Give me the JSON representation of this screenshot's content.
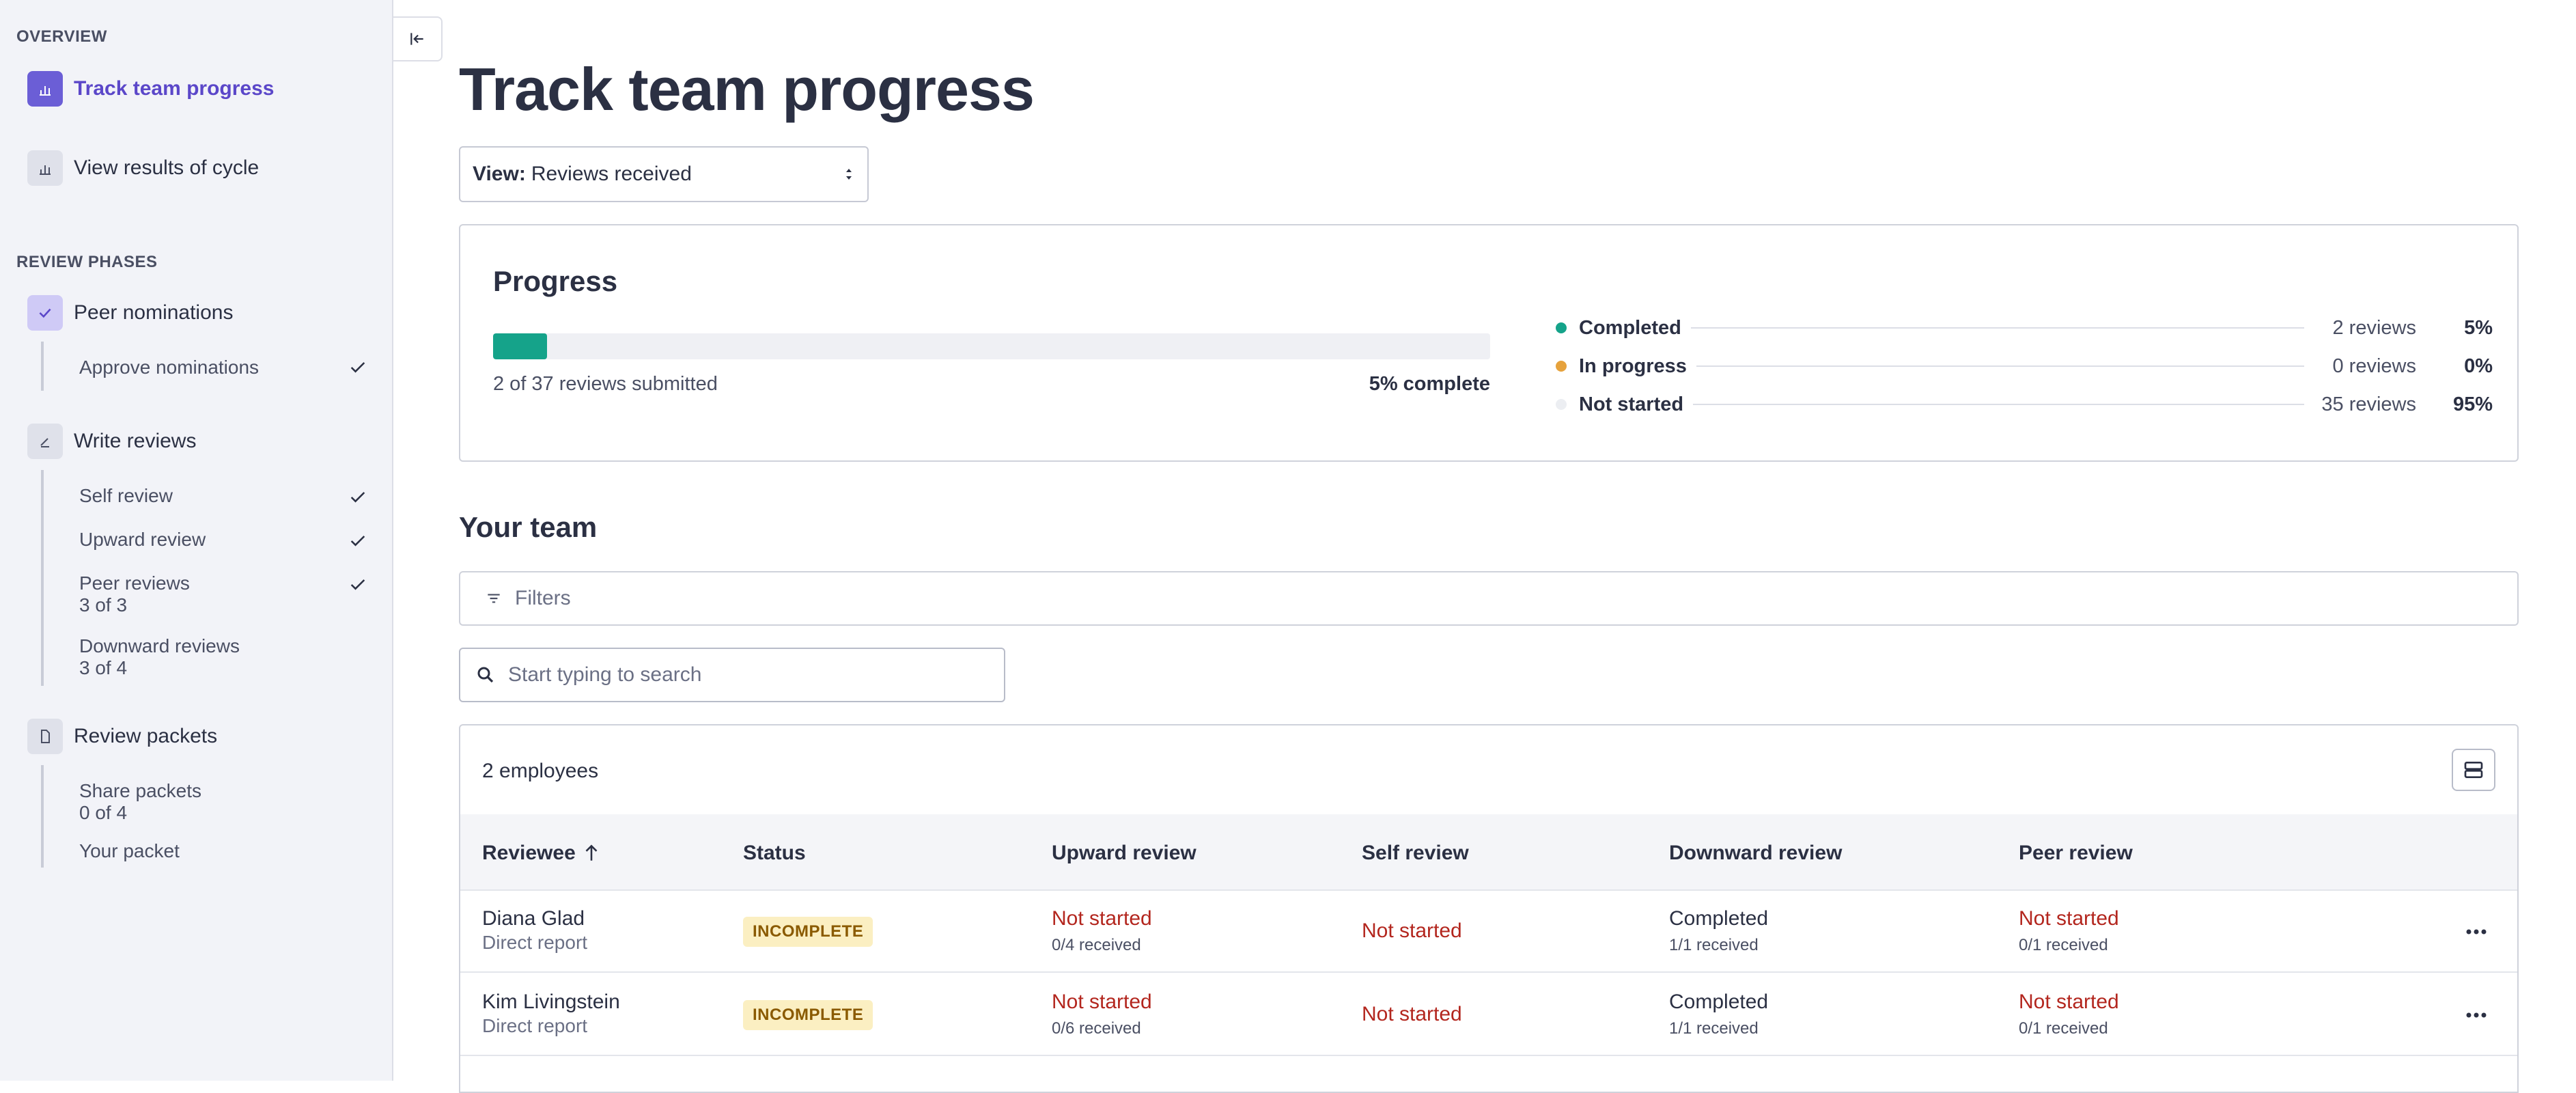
{
  "sidebar": {
    "overview_label": "OVERVIEW",
    "overview_items": [
      {
        "label": "Track team progress",
        "icon": "bar-chart-icon",
        "active": true
      },
      {
        "label": "View results of cycle",
        "icon": "bar-chart-icon",
        "active": false
      }
    ],
    "phases_label": "REVIEW PHASES",
    "phases": [
      {
        "label": "Peer nominations",
        "icon": "check-icon",
        "items": [
          {
            "label": "Approve nominations",
            "sub": "",
            "done": true
          }
        ]
      },
      {
        "label": "Write reviews",
        "icon": "pencil-icon",
        "items": [
          {
            "label": "Self review",
            "sub": "",
            "done": true
          },
          {
            "label": "Upward review",
            "sub": "",
            "done": true
          },
          {
            "label": "Peer reviews",
            "sub": "3 of 3",
            "done": true
          },
          {
            "label": "Downward reviews",
            "sub": "3 of 4",
            "done": false
          }
        ]
      },
      {
        "label": "Review packets",
        "icon": "document-icon",
        "items": [
          {
            "label": "Share packets",
            "sub": "0 of 4",
            "done": false
          },
          {
            "label": "Your packet",
            "sub": "",
            "done": false
          }
        ]
      }
    ]
  },
  "main": {
    "title": "Track team progress",
    "view_select": {
      "prefix": "View:",
      "value": "Reviews received"
    },
    "progress": {
      "title": "Progress",
      "fraction": 0.054,
      "submitted_text": "2 of 37 reviews submitted",
      "complete_text": "5% complete",
      "legend": [
        {
          "name": "Completed",
          "count": "2 reviews",
          "pct": "5%",
          "color": "#15a38a"
        },
        {
          "name": "In progress",
          "count": "0 reviews",
          "pct": "0%",
          "color": "#e6a23c"
        },
        {
          "name": "Not started",
          "count": "35 reviews",
          "pct": "95%",
          "color": "#eceef2"
        }
      ]
    },
    "team": {
      "title": "Your team",
      "filters_label": "Filters",
      "search_placeholder": "Start typing to search",
      "employee_count": "2 employees",
      "columns": [
        "Reviewee",
        "Status",
        "Upward review",
        "Self review",
        "Downward review",
        "Peer review"
      ],
      "rows": [
        {
          "name": "Diana Glad",
          "relation": "Direct report",
          "status": "INCOMPLETE",
          "upward": {
            "status": "Not started",
            "received": "0/4 received"
          },
          "self": {
            "status": "Not started"
          },
          "downward": {
            "status": "Completed",
            "received": "1/1 received"
          },
          "peer": {
            "status": "Not started",
            "received": "0/1 received"
          }
        },
        {
          "name": "Kim Livingstein",
          "relation": "Direct report",
          "status": "INCOMPLETE",
          "upward": {
            "status": "Not started",
            "received": "0/6 received"
          },
          "self": {
            "status": "Not started"
          },
          "downward": {
            "status": "Completed",
            "received": "1/1 received"
          },
          "peer": {
            "status": "Not started",
            "received": "0/1 received"
          }
        }
      ]
    }
  }
}
